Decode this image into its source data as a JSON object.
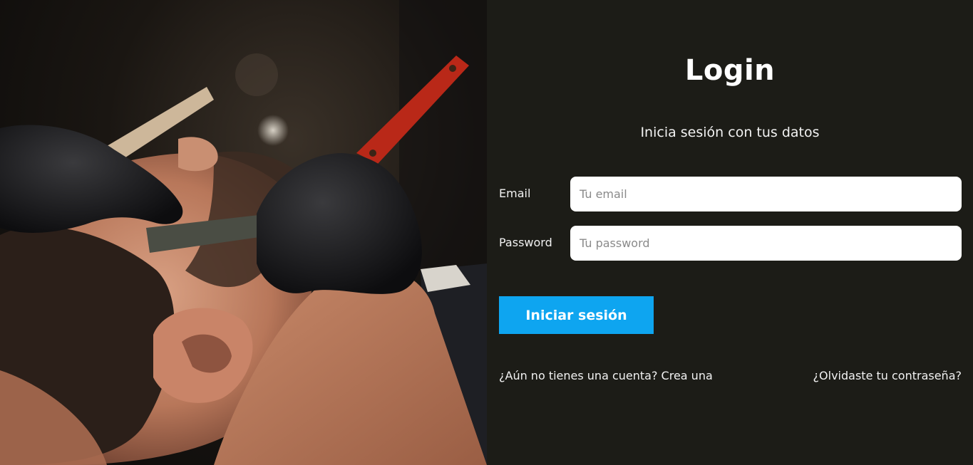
{
  "hero": {
    "image_alt": "Barbero afeitando la barba de un cliente con navaja"
  },
  "login": {
    "title": "Login",
    "subtitle": "Inicia sesión con tus datos",
    "email_label": "Email",
    "email_placeholder": "Tu email",
    "email_value": "",
    "password_label": "Password",
    "password_placeholder": "Tu password",
    "password_value": "",
    "submit_label": "Iniciar sesión",
    "register_link": "¿Aún no tienes una cuenta? Crea una",
    "forgot_link": "¿Olvidaste tu contraseña?"
  },
  "colors": {
    "panel_background": "#1c1c17",
    "accent": "#0ea5f0",
    "text": "#ffffff",
    "input_background": "#ffffff"
  }
}
